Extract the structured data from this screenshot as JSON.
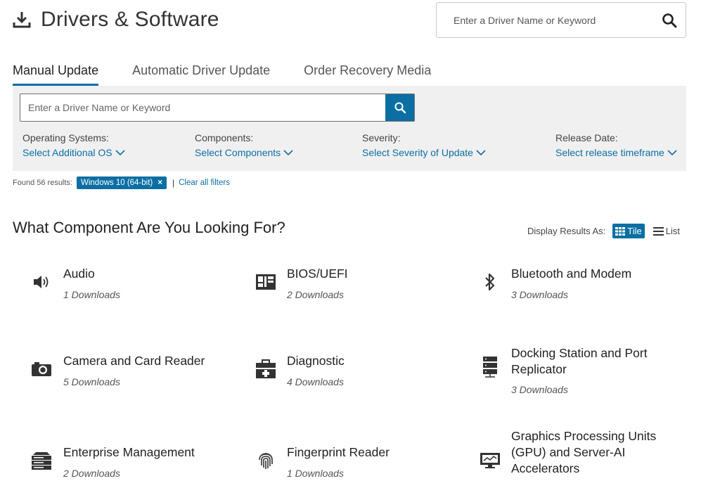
{
  "header": {
    "title": "Drivers & Software",
    "search_placeholder": "Enter a Driver Name or Keyword"
  },
  "tabs": [
    {
      "label": "Manual Update",
      "active": true
    },
    {
      "label": "Automatic Driver Update",
      "active": false
    },
    {
      "label": "Order Recovery Media",
      "active": false
    }
  ],
  "filters": {
    "search_placeholder": "Enter a Driver Name or Keyword",
    "os": {
      "label": "Operating Systems:",
      "select": "Select Additional OS"
    },
    "components": {
      "label": "Components:",
      "select": "Select Components"
    },
    "severity": {
      "label": "Severity:",
      "select": "Select Severity of Update"
    },
    "release": {
      "label": "Release Date:",
      "select": "Select release timeframe"
    }
  },
  "results": {
    "found_text": "Found 56 results:",
    "chip": "Windows 10 (64-bit)",
    "chip_close": "×",
    "separator": "|",
    "clear": "Clear all filters"
  },
  "section": {
    "title": "What Component Are You Looking For?",
    "display_as": "Display Results As:",
    "tile_label": "Tile",
    "list_label": "List"
  },
  "components": [
    {
      "name": "Audio",
      "count": "1 Downloads",
      "icon": "speaker-icon"
    },
    {
      "name": "BIOS/UEFI",
      "count": "2 Downloads",
      "icon": "bios-chip-icon"
    },
    {
      "name": "Bluetooth and Modem",
      "count": "3 Downloads",
      "icon": "bluetooth-icon"
    },
    {
      "name": "Camera and Card Reader",
      "count": "5 Downloads",
      "icon": "camera-icon"
    },
    {
      "name": "Diagnostic",
      "count": "4 Downloads",
      "icon": "diagnostic-kit-icon"
    },
    {
      "name": "Docking Station and Port Replicator",
      "count": "3 Downloads",
      "icon": "docking-station-icon"
    },
    {
      "name": "Enterprise Management",
      "count": "2 Downloads",
      "icon": "server-icon"
    },
    {
      "name": "Fingerprint Reader",
      "count": "1 Downloads",
      "icon": "fingerprint-icon"
    },
    {
      "name": "Graphics Processing Units (GPU) and Server-AI Accelerators",
      "count": "",
      "icon": "monitor-icon"
    }
  ],
  "colors": {
    "accent": "#0b6fa4",
    "panel": "#f0f0f0"
  }
}
